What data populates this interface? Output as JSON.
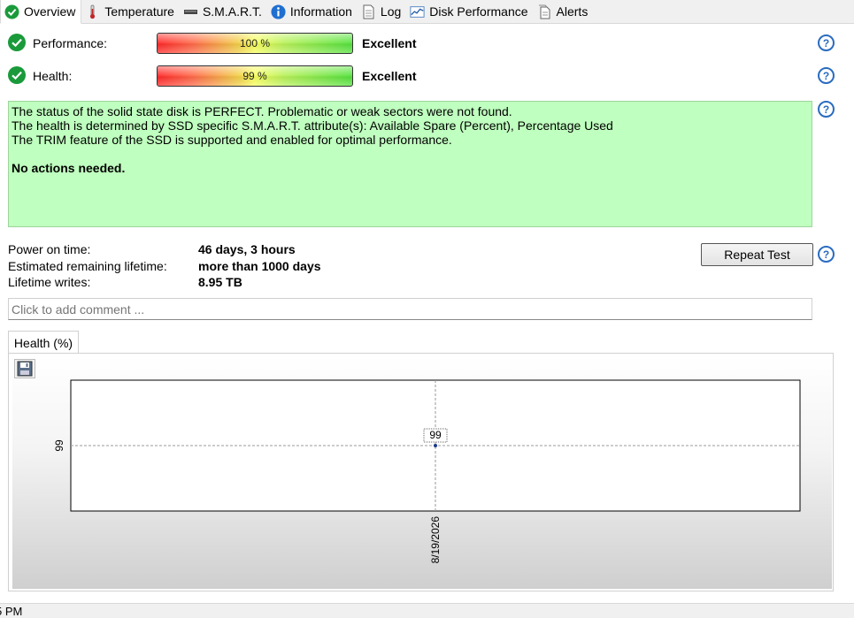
{
  "tabs": [
    {
      "label": "Overview",
      "icon": "check-icon",
      "active": true
    },
    {
      "label": "Temperature",
      "icon": "thermometer-icon"
    },
    {
      "label": "S.M.A.R.T.",
      "icon": "disk-drive-icon"
    },
    {
      "label": "Information",
      "icon": "info-icon"
    },
    {
      "label": "Log",
      "icon": "document-icon"
    },
    {
      "label": "Disk Performance",
      "icon": "chart-icon"
    },
    {
      "label": "Alerts",
      "icon": "alerts-document-icon"
    }
  ],
  "performance": {
    "label": "Performance:",
    "value_text": "100 %",
    "level": 100,
    "rating": "Excellent"
  },
  "health": {
    "label": "Health:",
    "value_text": "99 %",
    "level": 99,
    "rating": "Excellent"
  },
  "status_box": {
    "line1": "The status of the solid state disk is PERFECT. Problematic or weak sectors were not found.",
    "line2": "The health is determined by SSD specific S.M.A.R.T. attribute(s):  Available Spare (Percent), Percentage Used",
    "line3": "The TRIM feature of the SSD is supported and enabled for optimal performance.",
    "action": "No actions needed."
  },
  "info": {
    "power_on_label": "Power on time:",
    "power_on_value": "46 days, 3 hours",
    "lifetime_label": "Estimated remaining lifetime:",
    "lifetime_value": "more than 1000 days",
    "writes_label": "Lifetime writes:",
    "writes_value": "8.95 TB"
  },
  "repeat_test_label": "Repeat Test",
  "comment_placeholder": "Click to add comment ...",
  "chart_tab_label": "Health (%)",
  "help_symbol": "?",
  "status_bar_text": "5 PM",
  "colors": {
    "status_bg": "#bfffbf",
    "check_green": "#1a9a3a",
    "help_blue": "#2a6cc0"
  },
  "chart_data": {
    "type": "line",
    "x": [
      "8/19/2026"
    ],
    "series": [
      {
        "values": [
          99
        ]
      }
    ],
    "y_tick_labels": [
      "99"
    ],
    "x_tick_labels": [
      "8/19/2026"
    ],
    "data_labels": [
      "99"
    ],
    "grid": true
  }
}
